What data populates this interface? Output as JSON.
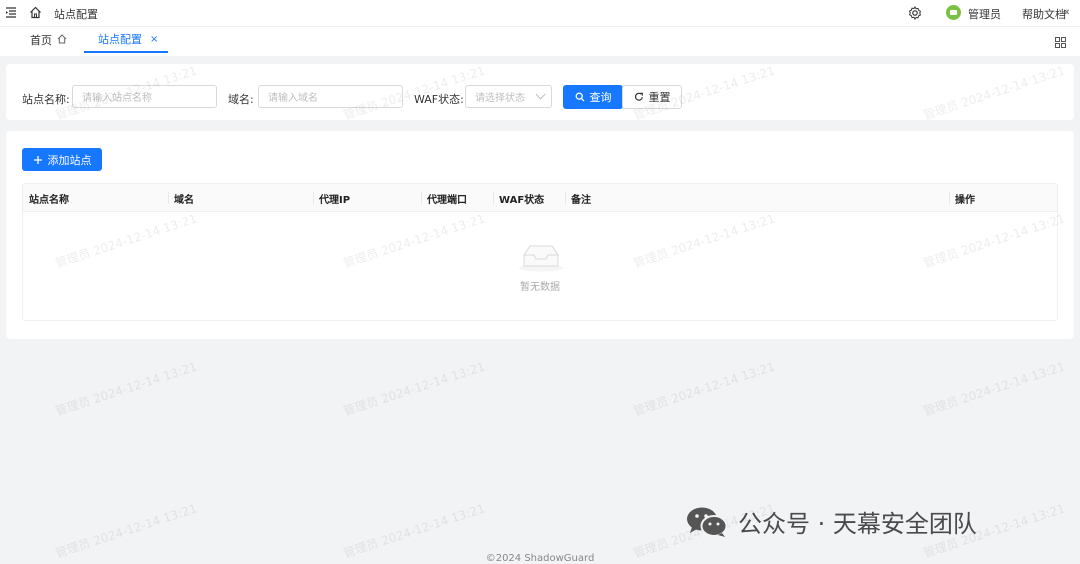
{
  "topbar": {
    "breadcrumb": "站点配置",
    "user_name": "管理员",
    "help": "帮助文档",
    "collapse_glyph": "«"
  },
  "tabs": [
    {
      "label": "首页",
      "icon": "home-icon"
    },
    {
      "label": "站点配置",
      "icon": "close-icon",
      "close_glyph": "×"
    }
  ],
  "search": {
    "site_name_label": "站点名称:",
    "site_name_placeholder": "请输入站点名称",
    "domain_label": "域名:",
    "domain_placeholder": "请输入域名",
    "waf_label": "WAF状态:",
    "waf_placeholder": "请选择状态",
    "query_label": "查询",
    "reset_label": "重置"
  },
  "toolbar": {
    "add_label": "添加站点"
  },
  "table": {
    "columns": [
      "站点名称",
      "域名",
      "代理IP",
      "代理端口",
      "WAF状态",
      "备注",
      "操作"
    ],
    "empty_text": "暂无数据"
  },
  "watermark": {
    "text": "管理员 2024-12-14 13:21"
  },
  "overlay": {
    "wechat_text": "公众号 · 天幕安全团队"
  },
  "footer": {
    "copyright": "©2024 ShadowGuard"
  },
  "colors": {
    "primary": "#1677ff",
    "avatar": "#7ac143"
  }
}
